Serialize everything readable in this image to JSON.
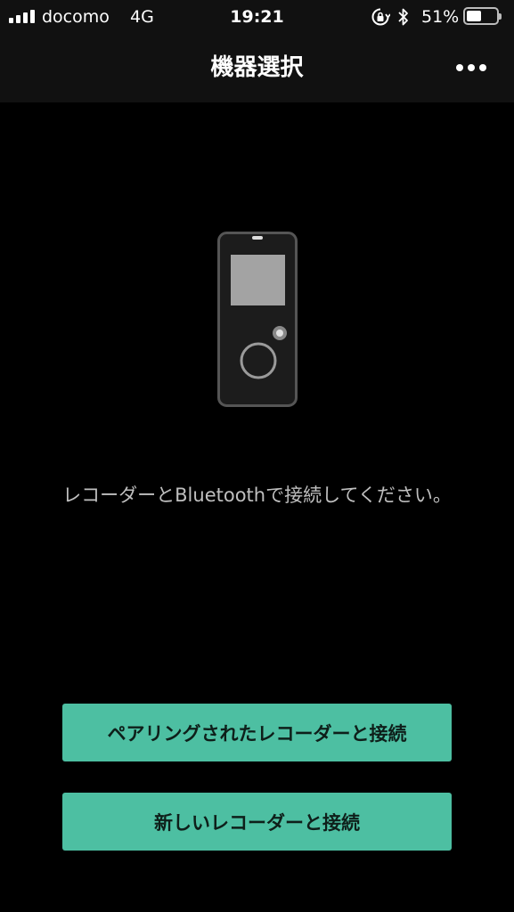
{
  "status_bar": {
    "carrier": "docomo",
    "network": "4G",
    "time": "19:21",
    "battery_percent": "51%",
    "battery_level": 0.51,
    "icons": [
      "signal-icon",
      "orientation-lock-icon",
      "bluetooth-icon",
      "battery-icon"
    ]
  },
  "nav": {
    "title": "機器選択",
    "more_icon": "more-horizontal-icon"
  },
  "main": {
    "illustration": "recorder-device-icon",
    "message": "レコーダーとBluetoothで接続してください。"
  },
  "actions": {
    "connect_paired_label": "ペアリングされたレコーダーと接続",
    "connect_new_label": "新しいレコーダーと接続"
  },
  "colors": {
    "background": "#000000",
    "bar_background": "#111111",
    "accent": "#4dbfa2"
  }
}
